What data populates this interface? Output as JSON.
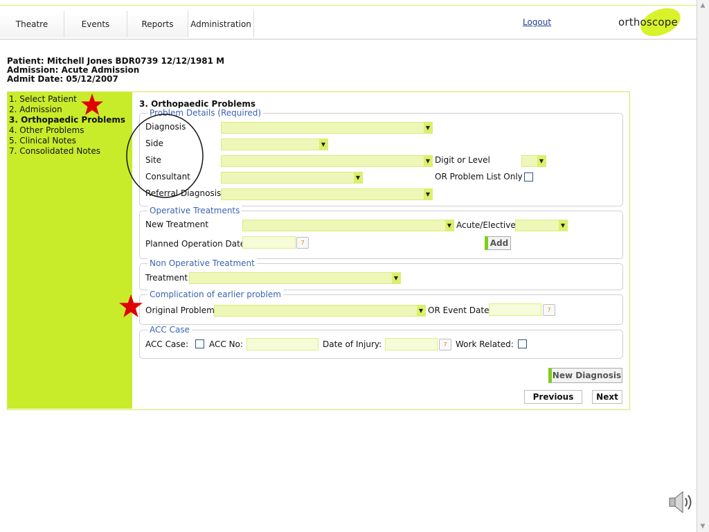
{
  "nav": {
    "tabs": [
      {
        "label": "Theatre"
      },
      {
        "label": "Events"
      },
      {
        "label": "Reports"
      },
      {
        "label": "Administration"
      }
    ],
    "logout_label": "Logout",
    "logo_text": "orthoscope",
    "logo_accent_color": "#d8f22c"
  },
  "patient": {
    "line1": "Patient: Mitchell Jones BDR0739 12/12/1981 M",
    "line2": "Admission: Acute Admission",
    "line3": "Admit Date: 05/12/2007"
  },
  "sidebar": {
    "steps": [
      {
        "label": "1. Select Patient",
        "current": false
      },
      {
        "label": "2. Admission",
        "current": false
      },
      {
        "label": "3. Orthopaedic Problems",
        "current": true
      },
      {
        "label": "4. Other Problems",
        "current": false
      },
      {
        "label": "5. Clinical Notes",
        "current": false
      },
      {
        "label": "7. Consolidated Notes",
        "current": false
      }
    ],
    "bg_color": "#c8ec2a"
  },
  "main": {
    "title": "3. Orthopaedic Problems",
    "problem_details": {
      "legend": "Problem Details (Required)",
      "diagnosis_label": "Diagnosis",
      "side_label": "Side",
      "site_label": "Site",
      "consultant_label": "Consultant",
      "referral_label": "Referral Diagnosis",
      "digit_label": "Digit or Level",
      "or_only_label": "OR Problem List Only"
    },
    "operative": {
      "legend": "Operative Treatments",
      "new_treatment_label": "New Treatment",
      "acute_label": "Acute/Elective",
      "planned_label": "Planned Operation Date",
      "add_label": "Add"
    },
    "non_operative": {
      "legend": "Non Operative Treatment",
      "treatment_label": "Treatment"
    },
    "complication": {
      "legend": "Complication of earlier problem",
      "original_label": "Original Problem",
      "event_date_label": "OR Event Date"
    },
    "acc": {
      "legend": "ACC Case",
      "case_label": "ACC Case:",
      "no_label": "ACC No:",
      "injury_label": "Date of Injury:",
      "work_label": "Work Related:"
    },
    "new_diagnosis_label": "New Diagnosis",
    "previous_label": "Previous",
    "next_label": "Next"
  },
  "icons": {
    "select_arrow": "chevron-down-icon",
    "calendar": "calendar-icon",
    "speaker": "speaker-icon"
  },
  "calendar_glyph": "7",
  "annotation_star_color": "#e00000"
}
